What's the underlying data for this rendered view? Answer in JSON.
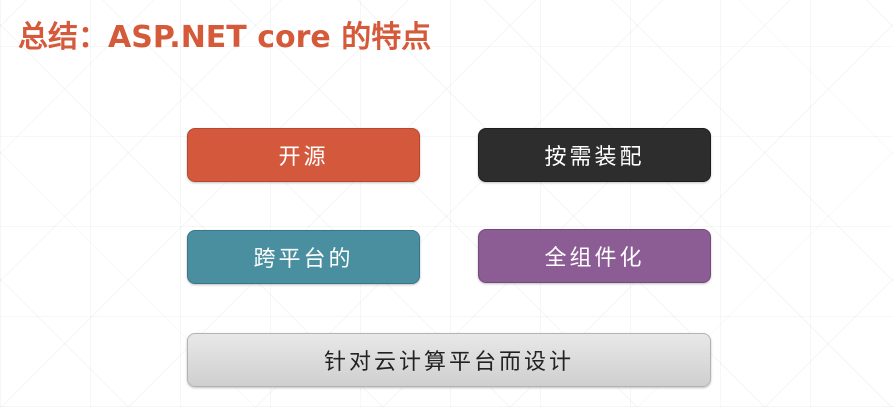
{
  "slide": {
    "title": "总结：ASP.NET core 的特点"
  },
  "features": {
    "open_source": "开源",
    "on_demand_assembly": "按需装配",
    "cross_platform": "跨平台的",
    "componentized": "全组件化",
    "cloud_design": "针对云计算平台而设计"
  },
  "colors": {
    "title": "#d55a3a",
    "open_source": "#d4593c",
    "on_demand_assembly": "#2d2d2d",
    "cross_platform": "#4a8fa0",
    "componentized": "#8c5c94",
    "cloud_design": "#dcdcdc"
  }
}
